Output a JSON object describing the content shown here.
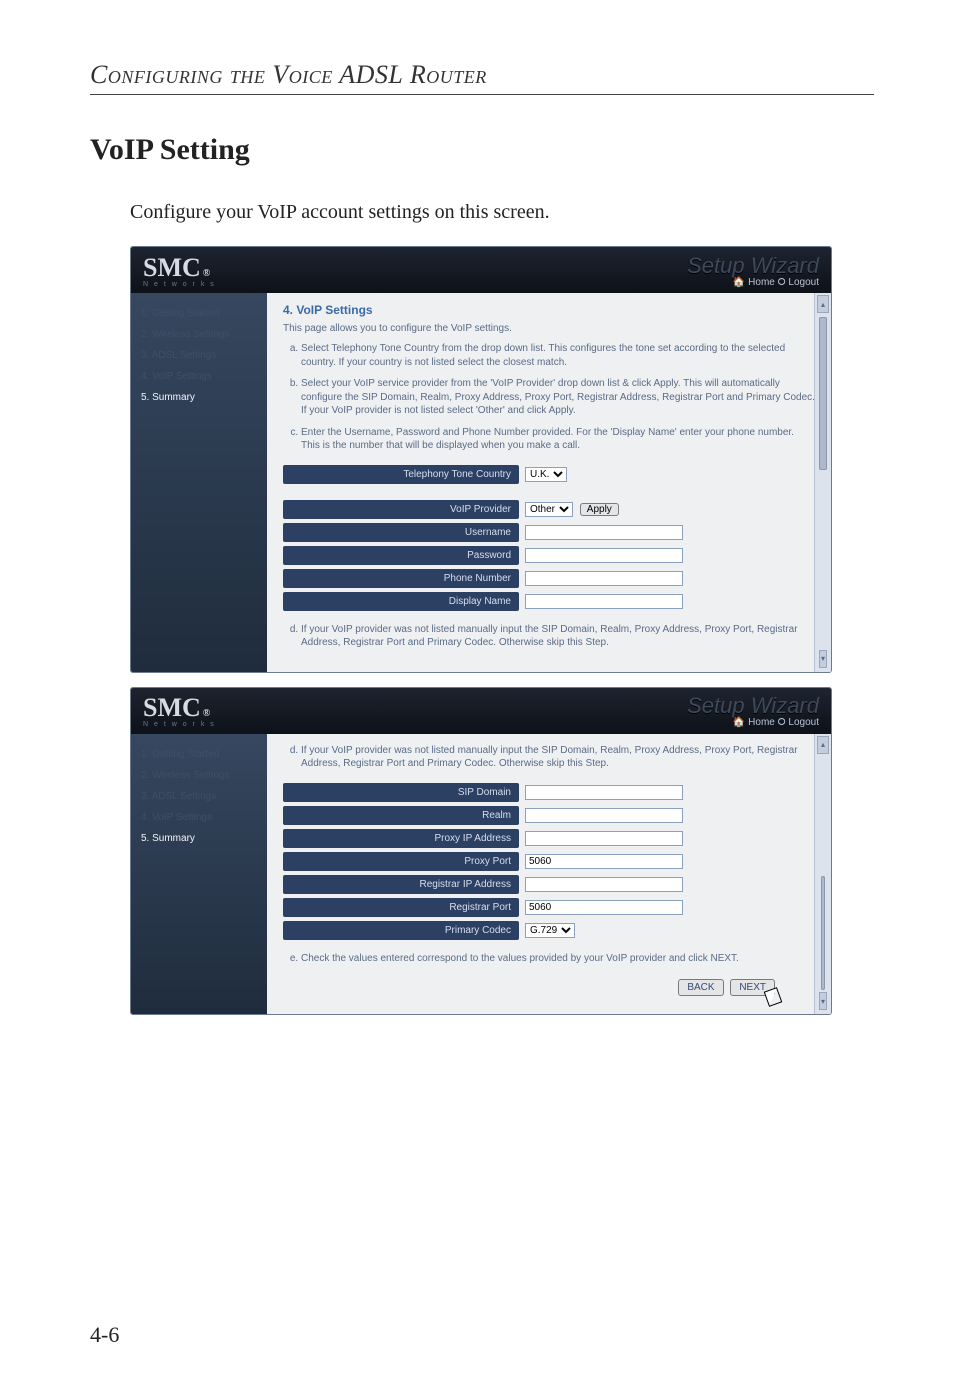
{
  "document": {
    "page_number": "4-6",
    "chapter_title": "Configuring the Voice ADSL Router",
    "section_title": "VoIP Setting",
    "intro_text": "Configure your VoIP account settings on this screen."
  },
  "brand": {
    "name": "SMC",
    "mark": "®",
    "sub": "N e t w o r k s"
  },
  "setup_wizard_text": "Setup Wizard",
  "home_logout": {
    "home_icon": "🏠",
    "home": "Home",
    "sep": "  ",
    "logout_icon": "⭘",
    "logout": "Logout"
  },
  "nav": {
    "items": [
      {
        "label": "1. Getting Started"
      },
      {
        "label": "2. Wireless Settings"
      },
      {
        "label": "3. ADSL Settings"
      },
      {
        "label": "4. VoIP Settings"
      },
      {
        "label": "5. Summary"
      }
    ]
  },
  "screen1": {
    "heading": "4. VoIP Settings",
    "intro": "This page allows you to configure the VoIP settings.",
    "steps": {
      "a": "Select Telephony Tone Country from the drop down list. This configures the tone set according to the selected country. If your country is not listed select the closest match.",
      "b": "Select your VoIP service provider from the 'VoIP Provider' drop down list & click Apply. This will automatically configure the SIP Domain, Realm, Proxy Address, Proxy Port, Registrar Address, Registrar Port and Primary Codec. If your VoIP provider is not listed select 'Other' and click Apply.",
      "c": "Enter the Username, Password and Phone Number provided. For the 'Display Name' enter your phone number. This is the number that will be displayed when you make a call.",
      "d": "If your VoIP provider was not listed manually input the SIP Domain, Realm, Proxy Address, Proxy Port, Registrar Address, Registrar Port and Primary Codec. Otherwise skip this Step."
    },
    "fields": {
      "tone_country_label": "Telephony Tone Country",
      "tone_country_value": "U.K.",
      "provider_label": "VoIP Provider",
      "provider_value": "Other",
      "apply_label": "Apply",
      "username_label": "Username",
      "username_value": "",
      "password_label": "Password",
      "password_value": "",
      "phone_label": "Phone Number",
      "phone_value": "",
      "display_label": "Display Name",
      "display_value": ""
    }
  },
  "screen2": {
    "steps": {
      "d": "If your VoIP provider was not listed manually input the SIP Domain, Realm, Proxy Address, Proxy Port, Registrar Address, Registrar Port and Primary Codec. Otherwise skip this Step.",
      "e": "Check the values entered correspond to the values provided by your VoIP provider and click NEXT."
    },
    "fields": {
      "sip_domain_label": "SIP Domain",
      "sip_domain_value": "",
      "realm_label": "Realm",
      "realm_value": "",
      "proxy_ip_label": "Proxy IP Address",
      "proxy_ip_value": "",
      "proxy_port_label": "Proxy Port",
      "proxy_port_value": "5060",
      "reg_ip_label": "Registrar IP Address",
      "reg_ip_value": "",
      "reg_port_label": "Registrar Port",
      "reg_port_value": "5060",
      "codec_label": "Primary Codec",
      "codec_value": "G.729"
    },
    "buttons": {
      "back": "BACK",
      "next": "NEXT"
    }
  }
}
